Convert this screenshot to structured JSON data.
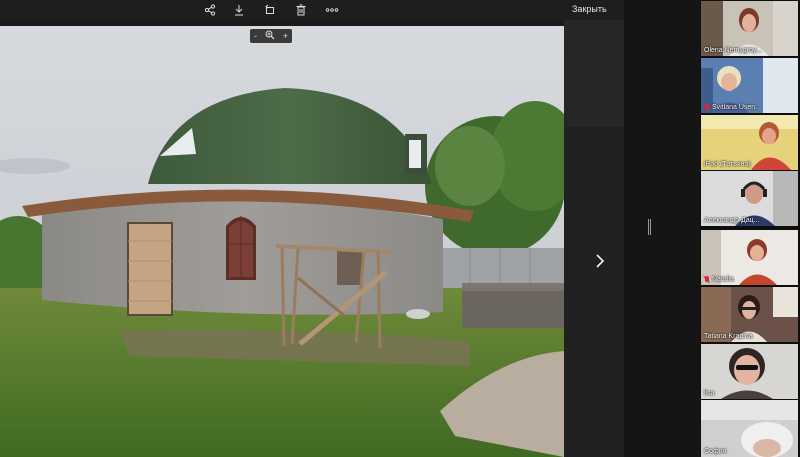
{
  "toolbar": {
    "icons": [
      "share-icon",
      "download-icon",
      "rotate-icon",
      "delete-icon",
      "more-icon"
    ],
    "close_label": "Закрыть"
  },
  "zoom": {
    "minus": "-",
    "plus": "+"
  },
  "viewer": {
    "next_icon": "chevron-right-icon",
    "resize_icon": "resize-grip-icon"
  },
  "colors": {
    "active_speaker": "#c8e02a",
    "muted": "#e0262b"
  },
  "participants": [
    {
      "name": "Olena Nemygroy...",
      "muted": false,
      "active": false
    },
    {
      "name": "Svitlana Usen...",
      "muted": true,
      "active": false
    },
    {
      "name": "iPad (Татьяна)",
      "muted": false,
      "active": false
    },
    {
      "name": "Александр Дац...",
      "muted": false,
      "active": true
    },
    {
      "name": "Natalia",
      "muted": true,
      "active": false
    },
    {
      "name": "Tatiana Krapina",
      "muted": false,
      "active": false
    },
    {
      "name": "lisa",
      "muted": false,
      "active": false
    },
    {
      "name": "София",
      "muted": false,
      "active": false
    }
  ]
}
